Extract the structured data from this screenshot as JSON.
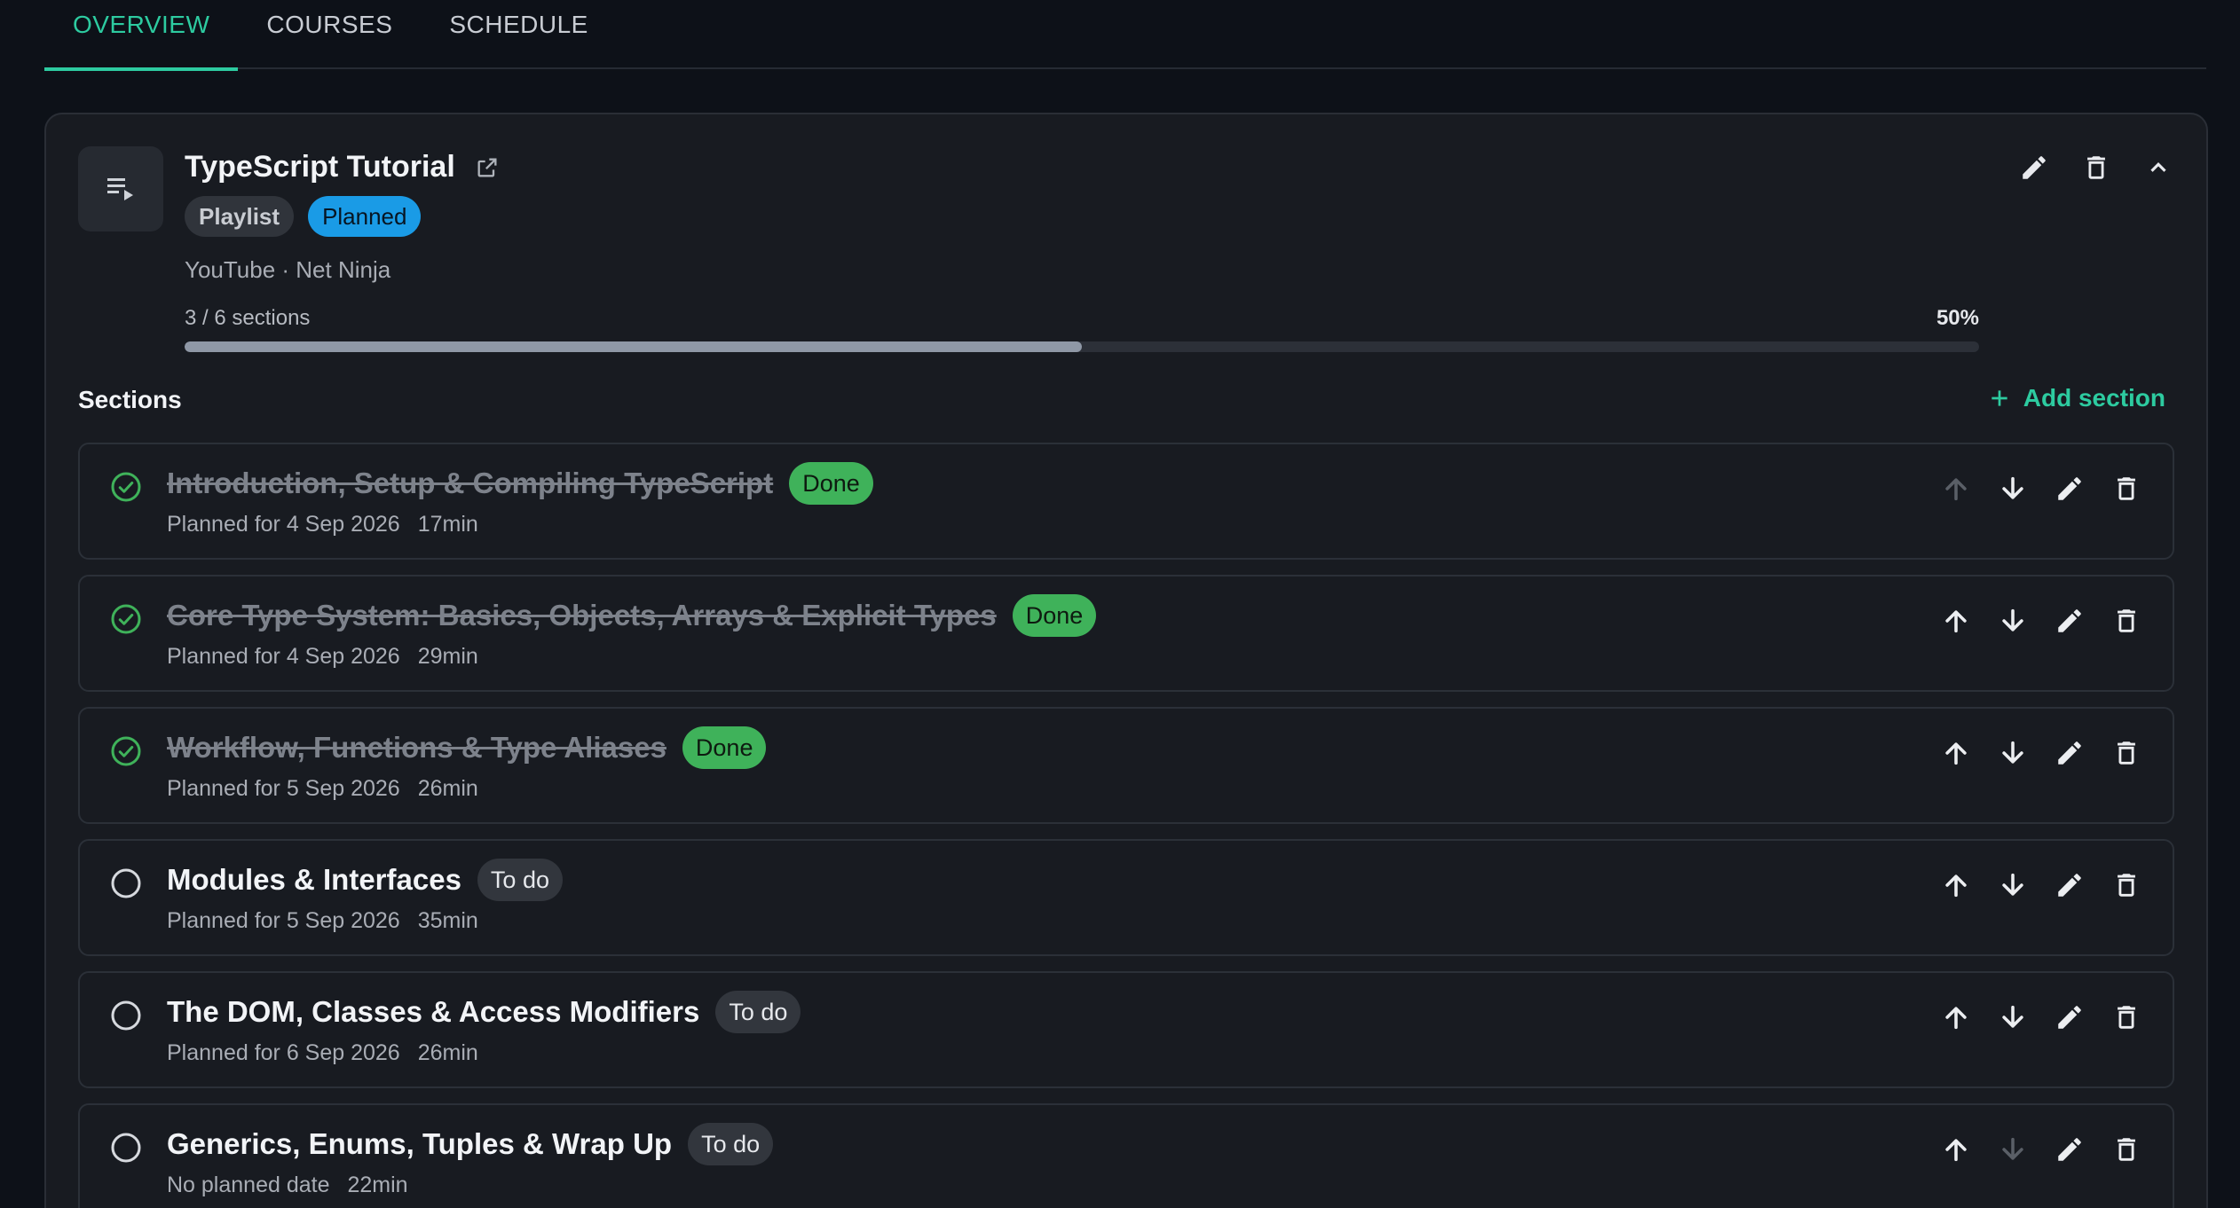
{
  "tabs": [
    {
      "label": "OVERVIEW",
      "active": true
    },
    {
      "label": "COURSES",
      "active": false
    },
    {
      "label": "SCHEDULE",
      "active": false
    }
  ],
  "course": {
    "title": "TypeScript Tutorial",
    "type_badge": "Playlist",
    "status_badge": "Planned",
    "meta": "YouTube · Net Ninja",
    "progress_label": "3 / 6 sections",
    "progress_pct_label": "50%",
    "progress_fraction": 0.5
  },
  "sections_label": "Sections",
  "add_section_label": "Add section",
  "rows": [
    {
      "title": "Introduction, Setup & Compiling TypeScript",
      "status": "Done",
      "done": true,
      "planned": "Planned for 4 Sep 2026",
      "duration": "17min",
      "up_disabled": true,
      "down_disabled": false
    },
    {
      "title": "Core Type System: Basics, Objects, Arrays & Explicit Types",
      "status": "Done",
      "done": true,
      "planned": "Planned for 4 Sep 2026",
      "duration": "29min",
      "up_disabled": false,
      "down_disabled": false
    },
    {
      "title": "Workflow, Functions & Type Aliases",
      "status": "Done",
      "done": true,
      "planned": "Planned for 5 Sep 2026",
      "duration": "26min",
      "up_disabled": false,
      "down_disabled": false
    },
    {
      "title": "Modules & Interfaces",
      "status": "To do",
      "done": false,
      "planned": "Planned for 5 Sep 2026",
      "duration": "35min",
      "up_disabled": false,
      "down_disabled": false
    },
    {
      "title": "The DOM, Classes & Access Modifiers",
      "status": "To do",
      "done": false,
      "planned": "Planned for 6 Sep 2026",
      "duration": "26min",
      "up_disabled": false,
      "down_disabled": false
    },
    {
      "title": "Generics, Enums, Tuples & Wrap Up",
      "status": "To do",
      "done": false,
      "planned": "No planned date",
      "duration": "22min",
      "up_disabled": false,
      "down_disabled": true
    }
  ],
  "colors": {
    "accent": "#2dcba0",
    "done": "#3fb25a",
    "planned": "#1a9be6"
  },
  "icons": {
    "thumb": "playlist-icon",
    "external": "external-link-icon",
    "edit": "pencil-icon",
    "delete": "trash-icon",
    "collapse": "chevron-up-icon",
    "up": "arrow-up-icon",
    "down": "arrow-down-icon",
    "add": "plus-icon",
    "done_status": "check-circle-icon",
    "todo_status": "empty-circle-icon"
  }
}
